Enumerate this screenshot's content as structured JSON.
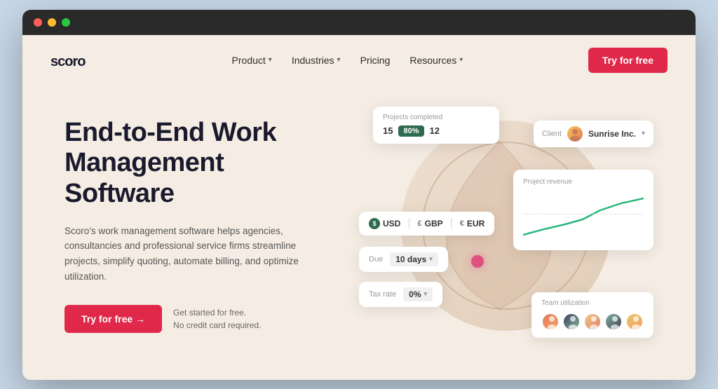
{
  "browser": {
    "dots": [
      "red",
      "yellow",
      "green"
    ]
  },
  "nav": {
    "logo": "scoro",
    "links": [
      {
        "label": "Product",
        "hasDropdown": true
      },
      {
        "label": "Industries",
        "hasDropdown": true
      },
      {
        "label": "Pricing",
        "hasDropdown": false
      },
      {
        "label": "Resources",
        "hasDropdown": true
      }
    ],
    "cta": "Try for free"
  },
  "hero": {
    "title": "End-to-End Work Management Software",
    "subtitle": "Scoro's work management software helps agencies, consultancies and professional service firms streamline projects, simplify quoting, automate billing, and optimize utilization.",
    "cta_button": "Try for free →",
    "cta_note_line1": "Get started for free.",
    "cta_note_line2": "No credit card required."
  },
  "cards": {
    "projects": {
      "label": "Projects completed",
      "num_left": "15",
      "badge": "80%",
      "num_right": "12"
    },
    "client": {
      "label": "Client",
      "name": "Sunrise Inc.",
      "has_dropdown": true
    },
    "currency": {
      "items": [
        "USD",
        "GBP",
        "EUR"
      ]
    },
    "due": {
      "label": "Due",
      "value": "10 days",
      "has_dropdown": true
    },
    "tax": {
      "label": "Tax rate",
      "value": "0%",
      "has_dropdown": true
    },
    "revenue": {
      "title": "Project revenue"
    },
    "team": {
      "title": "Team utilization"
    }
  }
}
